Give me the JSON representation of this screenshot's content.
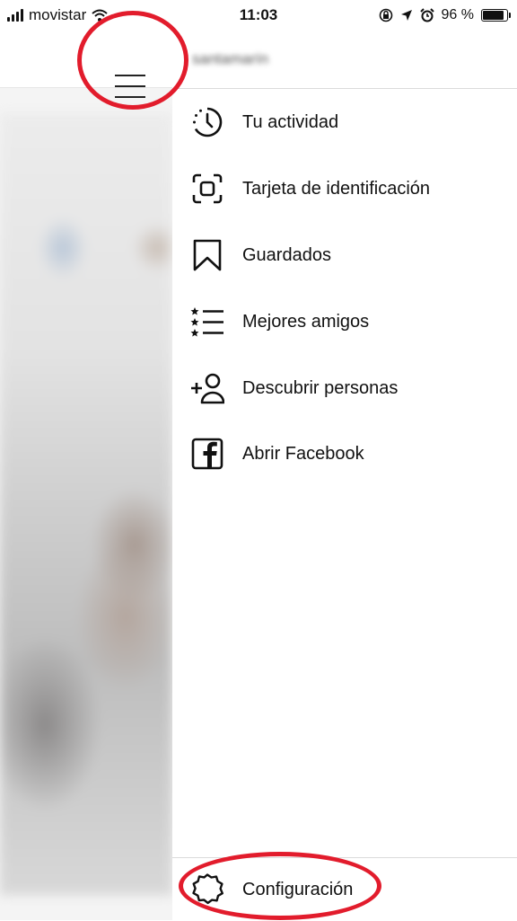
{
  "status_bar": {
    "carrier": "movistar",
    "time": "11:03",
    "battery_percent": "96 %",
    "battery_level": 0.96,
    "icons": [
      "signal-icon",
      "wifi-icon",
      "orientation-lock-icon",
      "location-arrow-icon",
      "alarm-icon",
      "battery-icon"
    ]
  },
  "background_screen": {
    "menu_icon": "hamburger-menu-icon"
  },
  "drawer": {
    "username": "santamarín",
    "items": [
      {
        "label": "Tu actividad",
        "icon": "activity-clock-icon"
      },
      {
        "label": "Tarjeta de identificación",
        "icon": "nametag-scan-icon"
      },
      {
        "label": "Guardados",
        "icon": "bookmark-icon"
      },
      {
        "label": "Mejores amigos",
        "icon": "close-friends-list-icon"
      },
      {
        "label": "Descubrir personas",
        "icon": "add-person-icon"
      },
      {
        "label": "Abrir Facebook",
        "icon": "facebook-icon"
      }
    ],
    "footer": {
      "label": "Configuración",
      "icon": "gear-icon"
    }
  },
  "annotation_color": "#e21c2c"
}
